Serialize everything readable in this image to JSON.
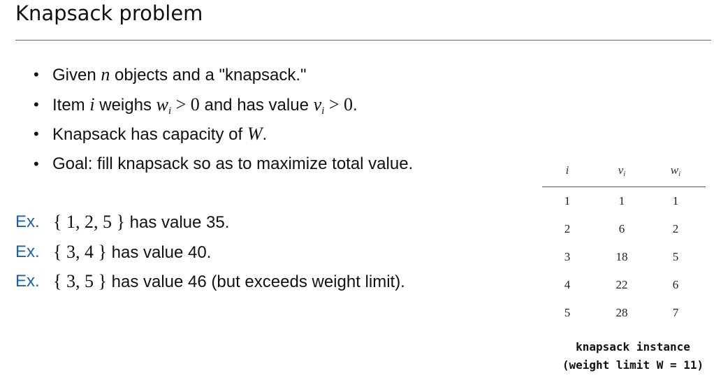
{
  "slide": {
    "title": "Knapsack problem"
  },
  "bullets": [
    {
      "dot": "•",
      "parts": [
        {
          "t": "Given ",
          "s": "text"
        },
        {
          "t": "n",
          "s": "math"
        },
        {
          "t": " objects and a \"knapsack.\"",
          "s": "text"
        }
      ]
    },
    {
      "dot": "•",
      "parts": [
        {
          "t": "Item ",
          "s": "text"
        },
        {
          "t": "i",
          "s": "math"
        },
        {
          "t": " weighs ",
          "s": "text"
        },
        {
          "t": "w",
          "s": "math"
        },
        {
          "t": "i",
          "s": "sub"
        },
        {
          "t": " > 0",
          "s": "mathu"
        },
        {
          "t": " and has value ",
          "s": "text"
        },
        {
          "t": "v",
          "s": "math"
        },
        {
          "t": "i",
          "s": "sub"
        },
        {
          "t": " > 0",
          "s": "mathu"
        },
        {
          "t": ".",
          "s": "text"
        }
      ]
    },
    {
      "dot": "•",
      "parts": [
        {
          "t": "Knapsack has capacity of ",
          "s": "text"
        },
        {
          "t": "W",
          "s": "math"
        },
        {
          "t": ".",
          "s": "text"
        }
      ]
    },
    {
      "dot": "•",
      "parts": [
        {
          "t": "Goal:  fill knapsack so as to maximize total value.",
          "s": "text"
        }
      ]
    }
  ],
  "examples": [
    {
      "label": "Ex.",
      "parts": [
        {
          "t": "{ 1, 2, 5 }",
          "s": "mathu"
        },
        {
          "t": " has value 35.",
          "s": "text"
        }
      ]
    },
    {
      "label": "Ex.",
      "parts": [
        {
          "t": "{ 3, 4 }",
          "s": "mathu"
        },
        {
          "t": " has value 40.",
          "s": "text"
        }
      ]
    },
    {
      "label": "Ex.",
      "parts": [
        {
          "t": "{ 3, 5 }",
          "s": "mathu"
        },
        {
          "t": " has value 46 (but exceeds weight limit).",
          "s": "text"
        }
      ]
    }
  ],
  "table": {
    "headers": {
      "i": "i",
      "v": "v",
      "v_sub": "i",
      "w": "w",
      "w_sub": "i"
    },
    "rows": [
      [
        "1",
        "1",
        "1"
      ],
      [
        "2",
        "6",
        "2"
      ],
      [
        "3",
        "18",
        "5"
      ],
      [
        "4",
        "22",
        "6"
      ],
      [
        "5",
        "28",
        "7"
      ]
    ],
    "caption_line1": "knapsack instance",
    "caption_line2": "(weight limit W = 11)"
  },
  "colors": {
    "ex_label": "#1d5fb3",
    "rule": "#6a6a6a"
  }
}
